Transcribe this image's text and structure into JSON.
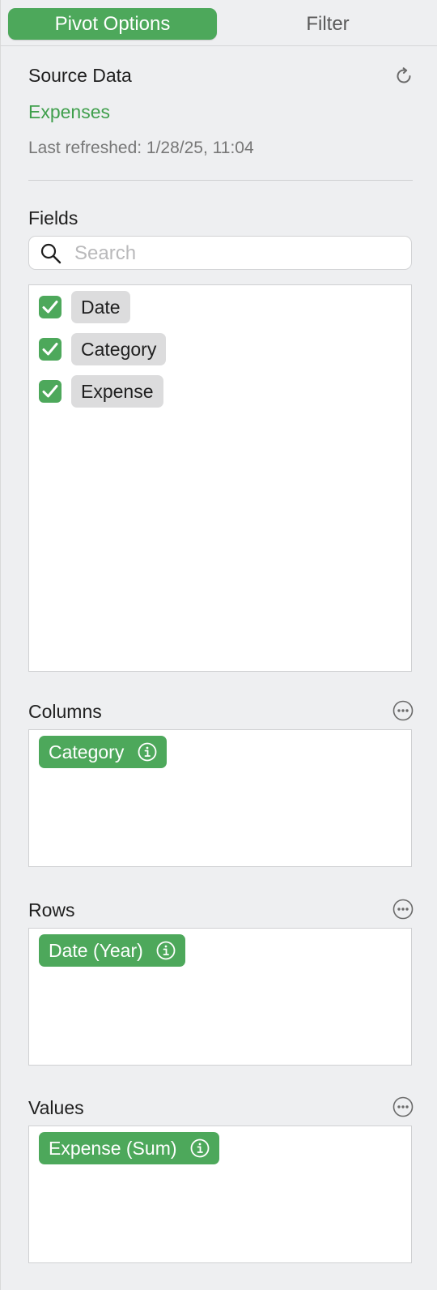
{
  "tabs": [
    {
      "label": "Pivot Options",
      "active": true
    },
    {
      "label": "Filter",
      "active": false
    }
  ],
  "source_data": {
    "title": "Source Data",
    "name": "Expenses",
    "last_refreshed": "Last refreshed: 1/28/25, 11:04",
    "refresh_icon": "refresh-icon"
  },
  "fields": {
    "title": "Fields",
    "search_placeholder": "Search",
    "search_value": "",
    "items": [
      {
        "label": "Date",
        "checked": true
      },
      {
        "label": "Category",
        "checked": true
      },
      {
        "label": "Expense",
        "checked": true
      }
    ]
  },
  "columns": {
    "title": "Columns",
    "pills": [
      "Category"
    ]
  },
  "rows": {
    "title": "Rows",
    "pills": [
      "Date (Year)"
    ]
  },
  "values": {
    "title": "Values",
    "pills": [
      "Expense (Sum)"
    ]
  },
  "colors": {
    "accent": "#4da85b",
    "source_link": "#3f9f4c",
    "background": "#eeeff1"
  }
}
